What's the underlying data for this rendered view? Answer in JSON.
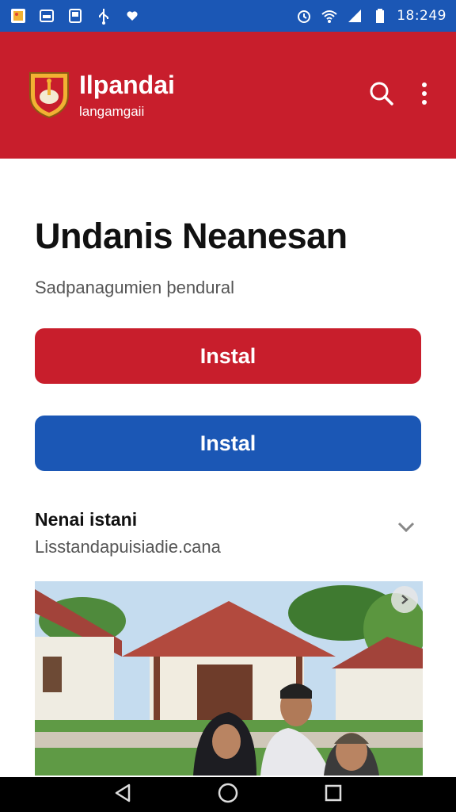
{
  "status_bar": {
    "time": "18:249",
    "icons": [
      "photos-icon",
      "window-icon",
      "tablet-icon",
      "usb-icon",
      "heart-icon",
      "alarm-icon",
      "wifi-icon",
      "signal-icon",
      "battery-icon"
    ]
  },
  "app_bar": {
    "title": "Ilpandai",
    "subtitle": "langamgaii",
    "actions": [
      "search-icon",
      "more-vert-icon"
    ]
  },
  "main": {
    "title": "Undanis Neanesan",
    "subtitle": "Sadpanagumien þendural",
    "primary_button": "Instal",
    "secondary_button": "Instal",
    "section": {
      "title": "Nenai istani",
      "subtitle": "Lisstandapuisiadie.cana"
    }
  },
  "colors": {
    "status_bar": "#1b57b5",
    "app_bar": "#c81e2c",
    "primary": "#c81e2c",
    "secondary": "#1b57b5"
  },
  "navigation": [
    "back-icon",
    "home-icon",
    "recents-icon"
  ]
}
